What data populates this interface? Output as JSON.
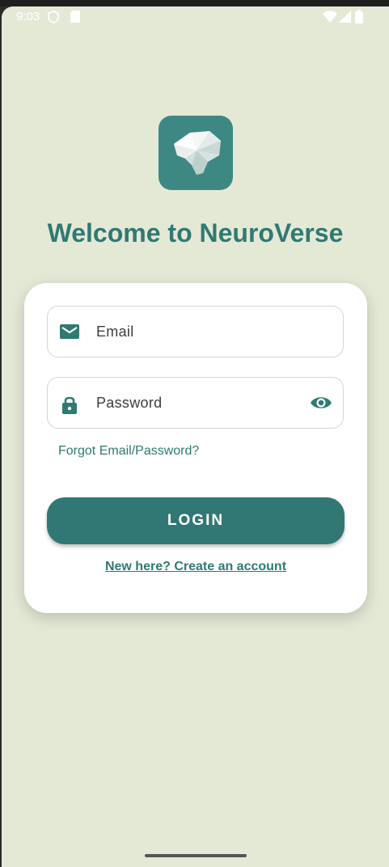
{
  "status_bar": {
    "time": "9:03",
    "icons": [
      "shield-icon",
      "sd-card-icon",
      "wifi-icon",
      "cell-signal-icon",
      "battery-icon"
    ]
  },
  "app": {
    "logo_icon": "brain-icon",
    "welcome": "Welcome to NeuroVerse"
  },
  "form": {
    "email_label": "Email",
    "email_icon": "mail-icon",
    "password_label": "Password",
    "password_icon": "lock-icon",
    "visibility_icon": "eye-icon",
    "forgot": "Forgot Email/Password?",
    "login": "LOGIN",
    "signup": "New here? Create an account"
  },
  "colors": {
    "background": "#e4e9d6",
    "accent": "#317773",
    "title": "#2f7a72",
    "card": "#ffffff"
  }
}
